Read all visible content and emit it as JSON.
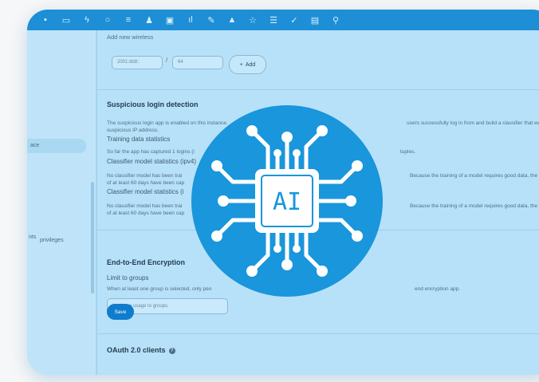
{
  "topbar": {
    "icons": [
      "app-icon",
      "image-icon",
      "bolt-icon",
      "search-icon",
      "list-icon",
      "people-icon",
      "calendar-icon",
      "chart-icon",
      "pencil-icon",
      "lock-icon",
      "star-icon",
      "menu-icon",
      "check-icon",
      "table-icon",
      "location-icon"
    ]
  },
  "sidebar": {
    "items": [
      {
        "label": "ace"
      },
      {
        "label": "nts",
        "sub": "privileges"
      }
    ]
  },
  "wireless": {
    "label": "Add new wireless",
    "prefix_placeholder": "2001:db8::",
    "mask_placeholder": "64",
    "slash": "/",
    "add_label": "Add"
  },
  "suspicious": {
    "title": "Suspicious login detection",
    "desc_left": "The suspicious login app is enabled on this instance.",
    "desc_right": "users successfully log in from and build a classifier that warns if a new login c",
    "desc_line2": "suspicious IP address.",
    "training_heading": "Training data statistics",
    "training_left": "So far the app has captured 1 logins (i",
    "training_right": "tuples.",
    "ipv4_heading": "Classifier model statistics (ipv4)",
    "ipv4_left": "No classifier model has been trai",
    "ipv4_right": "Because the training of a model requires good data, the ap",
    "ipv4_line2": "of at least 60 days have been cap",
    "ipv6_heading": "Classifier model statistics (i",
    "ipv6_left": "No classifier model has been trai",
    "ipv6_right": "Because the training of a model requires good data, the ap",
    "ipv6_line2": "of at least 60 days have been cap"
  },
  "e2e": {
    "title": "End-to-End Encryption",
    "limit_heading": "Limit to groups",
    "limit_desc_left": "When at least one group is selected, only peo",
    "limit_desc_right": "end encryption app.",
    "groups_placeholder": "Limit app usage to groups.",
    "save_label": "Save"
  },
  "oauth": {
    "title": "OAuth 2.0 clients",
    "help": "?"
  },
  "overlay": {
    "chip_text": "AI"
  },
  "colors": {
    "brand": "#1e8fd6",
    "overlay": "#1996dc",
    "save": "#0f7ccc"
  }
}
